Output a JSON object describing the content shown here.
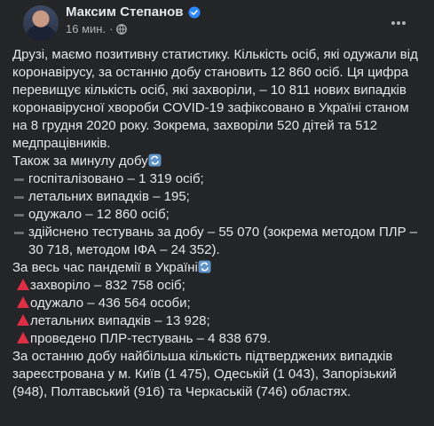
{
  "post": {
    "author": "Максим Степанов",
    "timestamp": "16 мин.",
    "privacy_icon": "globe-icon",
    "intro": "Друзі, маємо позитивну статистику. Кількість осіб, які одужали від коронавірусу, за останню добу становить 12 860 осіб. Ця цифра перевищує кількість осіб, які захворіли, – 10 811 нових випадків коронавірусної хвороби COVID-19 зафіксовано в Україні станом на 8 грудня 2020 року. Зокрема, захворіли 520 дітей та 512 медпрацівників.",
    "daily_title": "Також за минулу добу",
    "daily_items": [
      "госпіталізовано – 1 319 осіб;",
      "летальних випадків – 195;",
      "одужало – 12 860 осіб;",
      "здійснено тестувань за добу – 55 070 (зокрема методом ПЛР – 30 718, методом ІФА – 24 352)."
    ],
    "total_title": "За весь час пандемії в Україні",
    "total_items": [
      "захворіло – 832 758 осіб;",
      "одужало – 436 564 особи;",
      "летальних випадків – 13 928;",
      "проведено ПЛР-тестувань – 4 838 679."
    ],
    "regions": "За останню добу найбільша кількість підтверджених випадків зареєстрована у м. Київ (1 475), Одеській (1 043), Запорізький (948), Полтавський (916) та Черкаській (746) областях.",
    "colors": {
      "background": "#242526",
      "text": "#e4e6eb",
      "secondary": "#b0b3b8",
      "verified": "#2d88ff",
      "triangle": "#dd2e44",
      "refresh_emoji": "#5f94c8"
    }
  }
}
